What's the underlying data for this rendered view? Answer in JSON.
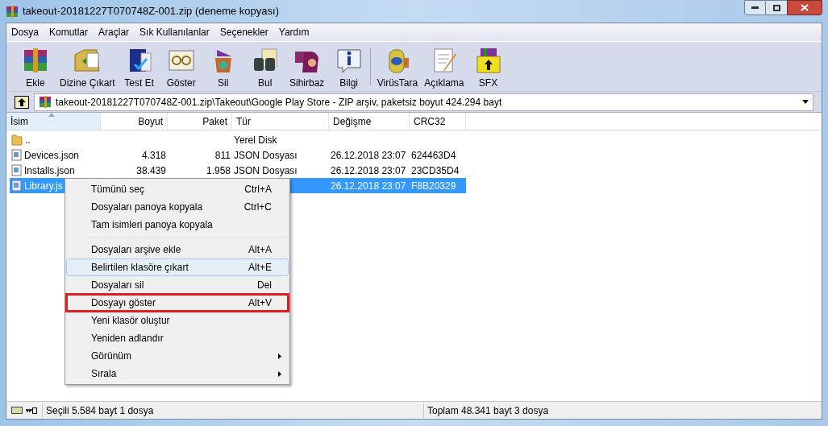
{
  "window": {
    "title": "takeout-20181227T070748Z-001.zip (deneme kopyası)"
  },
  "menu_bar": [
    "Dosya",
    "Komutlar",
    "Araçlar",
    "Sık Kullanılanlar",
    "Seçenekler",
    "Yardım"
  ],
  "toolbar": [
    {
      "label": "Ekle"
    },
    {
      "label": "Dizine Çıkart"
    },
    {
      "label": "Test Et"
    },
    {
      "label": "Göster"
    },
    {
      "label": "Sil"
    },
    {
      "label": "Bul"
    },
    {
      "label": "Sihirbaz"
    },
    {
      "label": "Bilgi"
    },
    {
      "label": "VirüsTara"
    },
    {
      "label": "Açıklama"
    },
    {
      "label": "SFX"
    }
  ],
  "address_bar": {
    "path": "takeout-20181227T070748Z-001.zip\\Takeout\\Google Play Store - ZIP arşiv, paketsiz boyut 424.294 bayt"
  },
  "table": {
    "columns": [
      {
        "label": "İsim",
        "sorted": true
      },
      {
        "label": "Boyut",
        "sorted": false
      },
      {
        "label": "Paket",
        "sorted": false
      },
      {
        "label": "Tür",
        "sorted": false
      },
      {
        "label": "Değişme",
        "sorted": false
      },
      {
        "label": "CRC32",
        "sorted": false
      }
    ],
    "rows": [
      {
        "kind": "folder",
        "selected": false,
        "cells": [
          "..",
          "",
          "",
          "Yerel Disk",
          "",
          ""
        ]
      },
      {
        "kind": "file",
        "selected": false,
        "cells": [
          "Devices.json",
          "4.318",
          "811",
          "JSON Dosyası",
          "26.12.2018 23:07",
          "624463D4"
        ]
      },
      {
        "kind": "file",
        "selected": false,
        "cells": [
          "Installs.json",
          "38.439",
          "1.958",
          "JSON Dosyası",
          "26.12.2018 23:07",
          "23CD35D4"
        ]
      },
      {
        "kind": "file",
        "selected": true,
        "cells": [
          "Library.js",
          "",
          "",
          "",
          "26.12.2018 23:07",
          "F8B20329"
        ]
      }
    ]
  },
  "context_menu": [
    {
      "kind": "item",
      "label": "Tümünü seç",
      "shortcut": "Ctrl+A",
      "hovered": false,
      "highlighted": false,
      "submenu": false
    },
    {
      "kind": "item",
      "label": "Dosyaları panoya kopyala",
      "shortcut": "Ctrl+C",
      "hovered": false,
      "highlighted": false,
      "submenu": false
    },
    {
      "kind": "item",
      "label": "Tam isimleri panoya kopyala",
      "hovered": false,
      "highlighted": false,
      "submenu": false
    },
    {
      "kind": "separator"
    },
    {
      "kind": "item",
      "label": "Dosyaları arşive ekle",
      "shortcut": "Alt+A",
      "hovered": false,
      "highlighted": false,
      "submenu": false
    },
    {
      "kind": "item",
      "label": "Belirtilen klasöre çıkart",
      "shortcut": "Alt+E",
      "hovered": true,
      "highlighted": false,
      "submenu": false
    },
    {
      "kind": "item",
      "label": "Dosyaları sil",
      "shortcut": "Del",
      "hovered": false,
      "highlighted": false,
      "submenu": false
    },
    {
      "kind": "item",
      "label": "Dosyayı göster",
      "shortcut": "Alt+V",
      "hovered": false,
      "highlighted": true,
      "submenu": false
    },
    {
      "kind": "item",
      "label": "Yeni klasör oluştur",
      "hovered": false,
      "highlighted": false,
      "submenu": false
    },
    {
      "kind": "item",
      "label": "Yeniden adlandır",
      "hovered": false,
      "highlighted": false,
      "submenu": false
    },
    {
      "kind": "item",
      "label": "Görünüm",
      "hovered": false,
      "highlighted": false,
      "submenu": true
    },
    {
      "kind": "item",
      "label": "Sırala",
      "hovered": false,
      "highlighted": false,
      "submenu": true
    }
  ],
  "status_bar": {
    "left": "Seçili 5.584 bayt 1 dosya",
    "right": "Toplam 48.341 bayt 3 dosya"
  }
}
